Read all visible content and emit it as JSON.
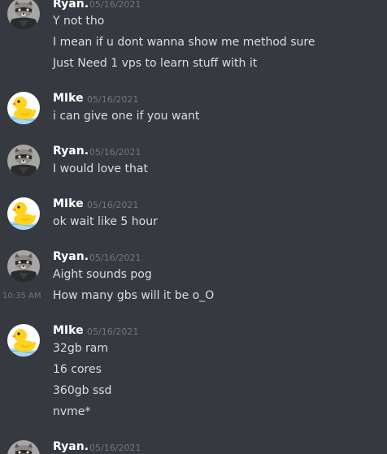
{
  "messages": [
    {
      "author": "Ryan.",
      "timestamp": "05/16/2021",
      "avatar_icon": "raccoon-avatar-icon",
      "lines": [
        "Y not tho",
        "I mean if u dont wanna show me method sure",
        "Just Need 1 vps to learn stuff with it"
      ]
    },
    {
      "author": "MIke",
      "timestamp": "05/16/2021",
      "avatar_icon": "duck-avatar-icon",
      "lines": [
        "i can give one if you want"
      ]
    },
    {
      "author": "Ryan.",
      "timestamp": "05/16/2021",
      "avatar_icon": "raccoon-avatar-icon",
      "lines": [
        "I would love that"
      ]
    },
    {
      "author": "MIke",
      "timestamp": "05/16/2021",
      "avatar_icon": "duck-avatar-icon",
      "lines": [
        "ok wait like 5 hour"
      ]
    },
    {
      "author": "Ryan.",
      "timestamp": "05/16/2021",
      "avatar_icon": "raccoon-avatar-icon",
      "lines": [
        "Aight sounds pog",
        "How many gbs will it be o_O"
      ],
      "hover_time": "10:35 AM"
    },
    {
      "author": "MIke",
      "timestamp": "05/16/2021",
      "avatar_icon": "duck-avatar-icon",
      "lines": [
        "32gb ram",
        "16 cores",
        "360gb ssd",
        "nvme*"
      ]
    },
    {
      "author": "Ryan.",
      "timestamp": "05/16/2021",
      "avatar_icon": "raccoon-avatar-icon",
      "lines": []
    }
  ],
  "colors": {
    "background": "#36393f",
    "username": "#ffffff",
    "message_text": "#dcddde",
    "timestamp": "#72767d"
  }
}
